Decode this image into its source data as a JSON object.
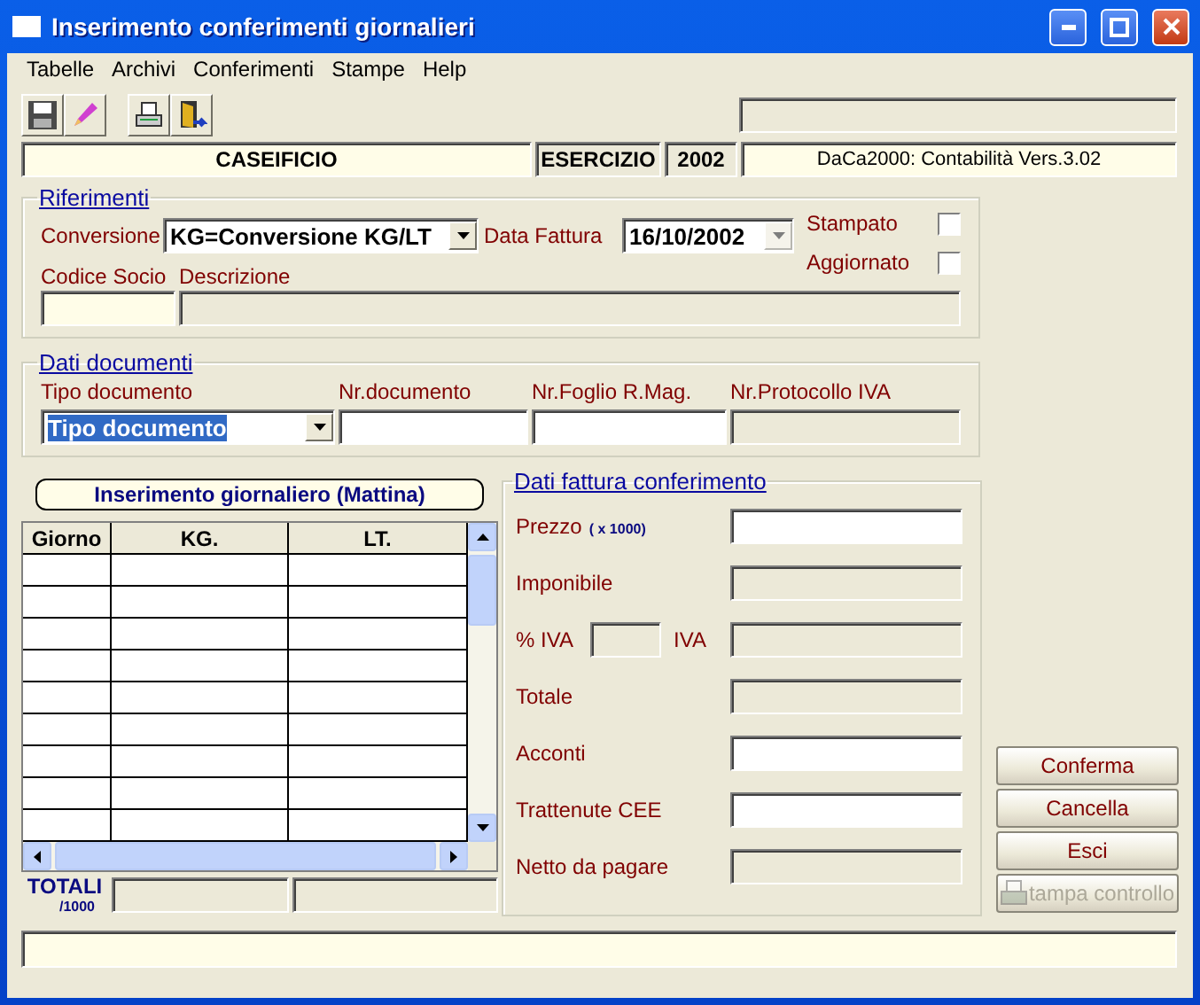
{
  "window": {
    "title": "Inserimento conferimenti giornalieri"
  },
  "menu": [
    "Tabelle",
    "Archivi",
    "Conferimenti",
    "Stampe",
    "Help"
  ],
  "toolbar": [
    {
      "kind": "save"
    },
    {
      "kind": "edit"
    },
    {
      "kind": "print"
    },
    {
      "kind": "exit"
    }
  ],
  "info_bar": {
    "company": "CASEIFICIO",
    "year_label": "ESERCIZIO",
    "year": "2002",
    "version": "DaCa2000: Contabilità Vers.3.02"
  },
  "riferimenti": {
    "title": "Riferimenti",
    "conversione_label": "Conversione",
    "conversione": "KG=Conversione KG/LT",
    "data_label": "Data Fattura",
    "data": "16/10/2002",
    "flags": [
      {
        "label": "Stampato",
        "checked": false
      },
      {
        "label": "Aggiornato",
        "checked": false
      }
    ],
    "codice_label": "Codice  Socio",
    "descrizione_label": "Descrizione"
  },
  "documenti": {
    "title": "Dati documenti",
    "columns": [
      {
        "label": "Tipo documento",
        "kind": "combo",
        "value": "Tipo documento",
        "highlighted": true,
        "disabled": false
      },
      {
        "label": "Nr.documento",
        "kind": "input",
        "disabled": false
      },
      {
        "label": "Nr.Foglio R.Mag.",
        "kind": "input",
        "disabled": false
      },
      {
        "label": "Nr.Protocollo IVA",
        "kind": "input",
        "disabled": true
      }
    ]
  },
  "grid": {
    "banner": "Inserimento giornaliero (Mattina)",
    "columns": [
      "Giorno",
      "KG.",
      "LT."
    ],
    "totals_label": "TOTALI",
    "totals_unit": "/1000"
  },
  "fattura": {
    "title": "Dati fattura conferimento",
    "fields": [
      {
        "label": "Prezzo",
        "note": "( x 1000)",
        "kind": "input",
        "disabled": false
      },
      {
        "label": "Imponibile",
        "kind": "input",
        "disabled": true
      },
      {
        "label": "% IVA",
        "sublabel": "IVA",
        "kind": "iva",
        "disabled": true
      },
      {
        "label": "Totale",
        "kind": "input",
        "disabled": true
      },
      {
        "label": "Acconti",
        "kind": "input",
        "disabled": false
      },
      {
        "label": "Trattenute CEE",
        "kind": "input",
        "disabled": false
      },
      {
        "label": "Netto da pagare",
        "kind": "input",
        "disabled": true
      }
    ]
  },
  "buttons": [
    {
      "label": "Conferma",
      "disabled": false
    },
    {
      "label": "Cancella",
      "disabled": false
    },
    {
      "label": "Esci",
      "disabled": false
    },
    {
      "label": "tampa controllo",
      "disabled": true,
      "icon": true
    }
  ]
}
